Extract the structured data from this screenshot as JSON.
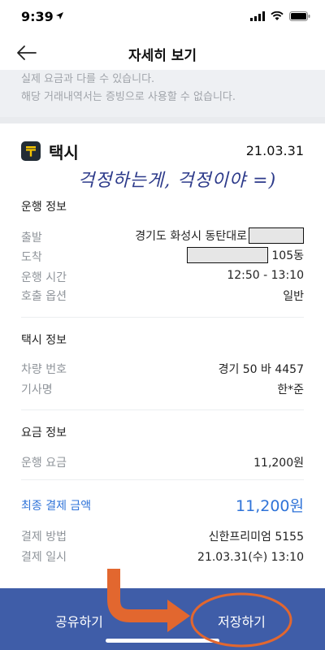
{
  "status_bar": {
    "time": "9:39",
    "icons": [
      "location-arrow-icon",
      "cellular-signal-icon",
      "wifi-icon",
      "battery-icon"
    ]
  },
  "header": {
    "title": "자세히 보기",
    "back_icon": "arrow-left-icon"
  },
  "notice": {
    "line1": "실제 요금과 다를 수 있습니다.",
    "line2": "해당 거래내역서는 증빙으로 사용할 수 없습니다."
  },
  "trip": {
    "service": "택시",
    "date": "21.03.31",
    "handwritten_note": "걱정하는게, 걱정이야 =)",
    "logo_icon": "kakao-t-icon"
  },
  "ride_info": {
    "title": "운행 정보",
    "departure_label": "출발",
    "departure_value": "경기도 화성시 동탄대로",
    "arrival_label": "도착",
    "arrival_value": "105동",
    "time_label": "운행 시간",
    "time_value": "12:50 - 13:10",
    "call_option_label": "호출 옵션",
    "call_option_value": "일반"
  },
  "taxi_info": {
    "title": "택시 정보",
    "plate_label": "차량 번호",
    "plate_value": "경기 50 바 4457",
    "driver_label": "기사명",
    "driver_value": "한*준"
  },
  "fare_info": {
    "title": "요금 정보",
    "fare_label": "운행 요금",
    "fare_value": "11,200원",
    "final_label": "최종 결제 금액",
    "final_value": "11,200원",
    "method_label": "결제 방법",
    "method_value": "신한프리미엄 5155",
    "paid_at_label": "결제 일시",
    "paid_at_value": "21.03.31(수) 13:10"
  },
  "actions": {
    "share_label": "공유하기",
    "save_label": "저장하기"
  },
  "colors": {
    "accent_blue": "#2f73d8",
    "bottom_bar": "#3f5da8",
    "annotation_orange": "#e2672f",
    "handwriting": "#2c3a8a"
  }
}
